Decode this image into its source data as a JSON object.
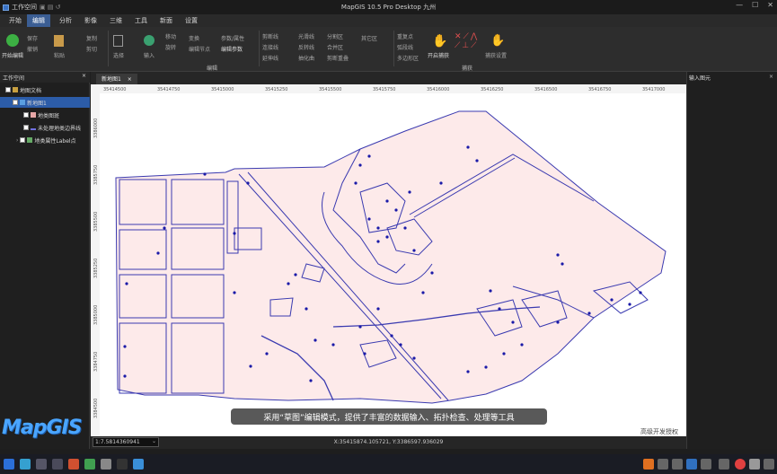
{
  "window": {
    "app_label": "工作空间",
    "title": "MapGIS 10.5 Pro Desktop 九州",
    "controls": [
      "—",
      "☐",
      "✕"
    ]
  },
  "menu": {
    "tabs": [
      "开始",
      "编辑",
      "分析",
      "影像",
      "三维",
      "工具",
      "新面",
      "设置"
    ],
    "active_index": 1
  },
  "ribbon": {
    "start_edit": "开始编辑",
    "save": "保存",
    "undo": "撤销",
    "copy": "复制",
    "cut": "剪切",
    "paste": "粘贴",
    "select": "选择",
    "input": "输入",
    "move": "移动",
    "rotate": "旋转",
    "transform": "变换",
    "edit_vertex": "编辑节点",
    "params_attrs": "参数/属性",
    "edit_params": "编辑参数",
    "cut_line": "剪断线",
    "merge_line": "连接线",
    "split_area": "分割区",
    "join_area": "合并区",
    "polygon_area": "多边形区",
    "smooth_line": "光滑线",
    "extend_line": "延伸线",
    "simplify": "抽化曲",
    "clip_area": "裁剪区",
    "union_area": "合并区",
    "cut_overlap": "剪断重叠",
    "other_area": "其它区",
    "duplicate_pt": "重复点",
    "isolated_line": "弧段线",
    "flip_line": "反转线",
    "start_catch": "开启捕获",
    "catch_settings": "捕获设置",
    "group_edit": "编辑",
    "group_catch": "捕获"
  },
  "left_panel": {
    "header": "工作空间",
    "tree": [
      {
        "label": "地图文档",
        "level": 0,
        "icon": "map-doc-icon"
      },
      {
        "label": "新地图1",
        "level": 1,
        "icon": "map-icon",
        "selected": true
      },
      {
        "label": "地类图斑",
        "level": 2,
        "icon": "polygon-layer-icon"
      },
      {
        "label": "未处理地类边界线",
        "level": 2,
        "icon": "line-layer-icon"
      },
      {
        "label": "地类属性Label点",
        "level": 2,
        "icon": "point-layer-icon"
      }
    ]
  },
  "map": {
    "tab_label": "新地图1",
    "ruler_x_labels": [
      "35414500",
      "35414750",
      "35415000",
      "35415250",
      "35415500",
      "35415750",
      "35416000",
      "35416250",
      "35416500",
      "35416750",
      "35417000"
    ],
    "ruler_y_labels": [
      "3386000",
      "3385750",
      "3385500",
      "3385250",
      "3385000",
      "3384750",
      "3384500"
    ],
    "fill_color": "#fdeaea",
    "line_color": "#3a3ab0",
    "point_color": "#1a1aa8"
  },
  "right_panel": {
    "header": "输入图元"
  },
  "status": {
    "scale": "1:7.5814360941",
    "coords": "X:35415874.105721, Y:3386597.936029"
  },
  "overlay": {
    "subtitle": "采用“草图”编辑模式，提供了丰富的数据输入、拓扑检查、处理等工具",
    "watermark": "高级开发授权",
    "logo": "MapGIS"
  }
}
